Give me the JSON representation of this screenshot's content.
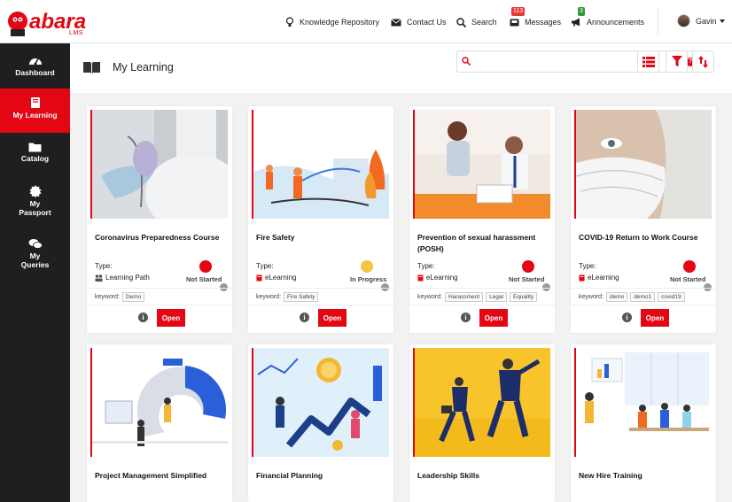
{
  "brand": {
    "name": "abara",
    "sub": "LMS",
    "accent": "#e30613"
  },
  "topnav": {
    "knowledge": "Knowledge Repository",
    "contact": "Contact Us",
    "search": "Search",
    "messages": "Messages",
    "messages_count": "113",
    "announcements": "Announcements",
    "announcements_count": "3",
    "user": "Gavin"
  },
  "sidebar": {
    "items": [
      {
        "label": "Dashboard",
        "icon": "gauge-icon"
      },
      {
        "label": "My Learning",
        "icon": "book-icon"
      },
      {
        "label": "Catalog",
        "icon": "folder-icon"
      },
      {
        "label": "My Passport",
        "icon": "badge-icon"
      },
      {
        "label": "My Queries",
        "icon": "chat-icon"
      }
    ]
  },
  "header": {
    "title": "My Learning",
    "search_placeholder": "",
    "help": "?"
  },
  "card_labels": {
    "type": "Type:",
    "keyword": "keyword:",
    "open": "Open",
    "info": "i"
  },
  "cards": [
    {
      "title": "Coronavirus Preparedness Course",
      "type": "Learning Path",
      "status": "Not Started",
      "keywords": [
        "Demo"
      ]
    },
    {
      "title": "Fire Safety",
      "type": "eLearning",
      "status": "In Progress",
      "keywords": [
        "Fire Safety"
      ]
    },
    {
      "title": "Prevention of sexual harassment (POSH)",
      "type": "eLearning",
      "status": "Not Started",
      "keywords": [
        "Harassment",
        "Legal",
        "Equality"
      ]
    },
    {
      "title": "COVID-19 Return to Work Course",
      "type": "eLearning",
      "status": "Not Started",
      "keywords": [
        "demo",
        "demo1",
        "covid19"
      ]
    },
    {
      "title": "Project Management Simplified"
    },
    {
      "title": "Financial Planning"
    },
    {
      "title": "Leadership Skills"
    },
    {
      "title": "New Hire Training"
    }
  ]
}
